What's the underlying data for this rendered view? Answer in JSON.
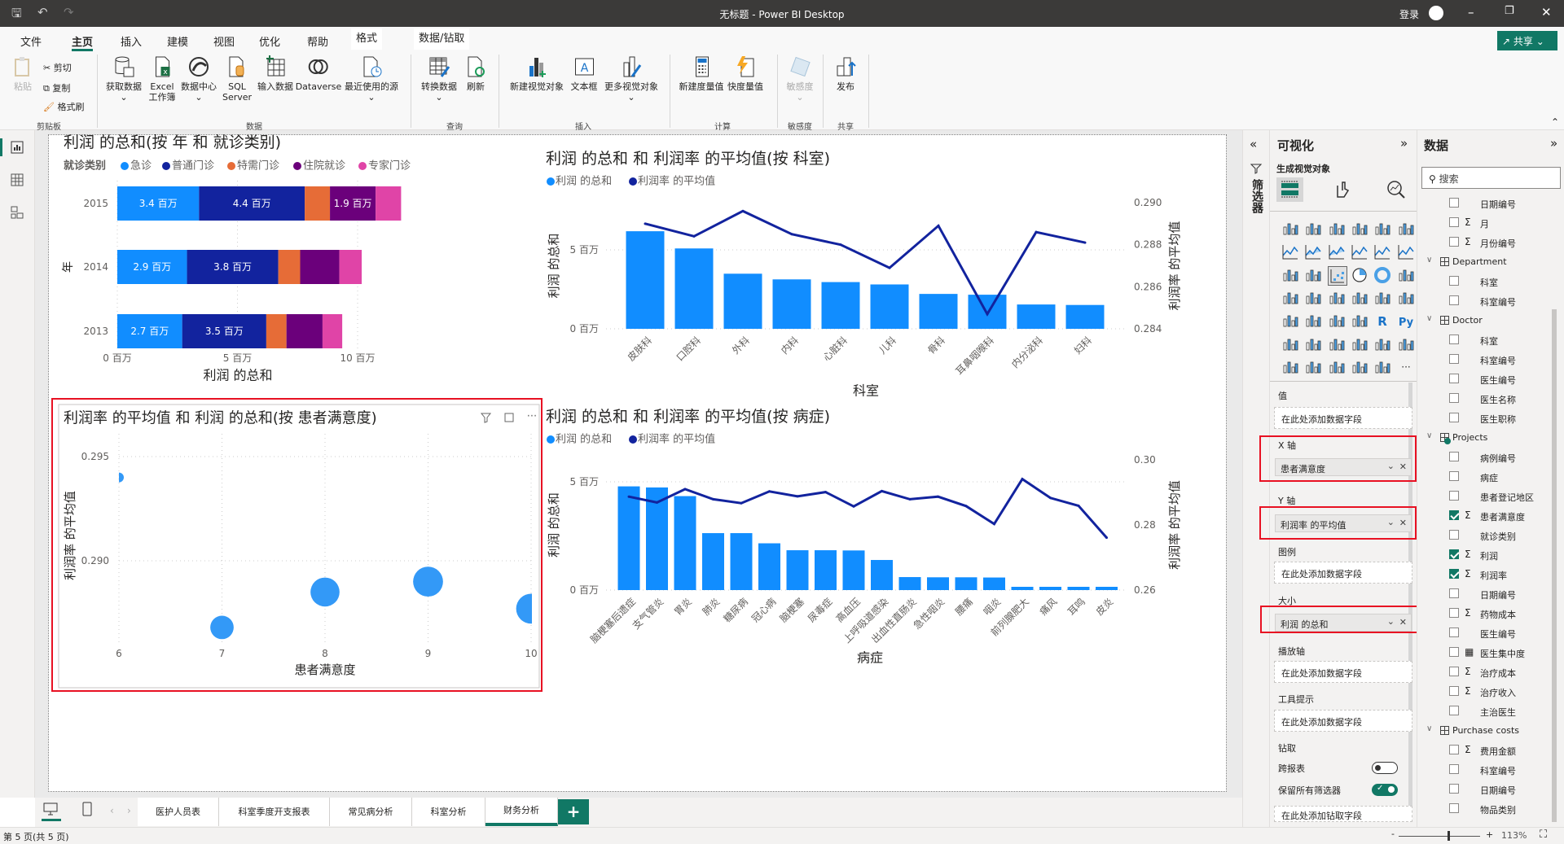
{
  "window": {
    "title": "无标题 - Power BI Desktop",
    "signin": "登录"
  },
  "menu_tabs": [
    "文件",
    "主页",
    "插入",
    "建模",
    "视图",
    "优化",
    "帮助",
    "格式",
    "数据/钻取"
  ],
  "active_menu_tab": "主页",
  "share_label": "共享",
  "ribbon": {
    "clipboard": {
      "paste": "粘贴",
      "cut": "剪切",
      "copy": "复制",
      "format_painter": "格式刷",
      "group": "剪贴板"
    },
    "data": {
      "get_data": "获取数据",
      "excel": "Excel",
      "excel2": "工作簿",
      "data_hub": "数据中心",
      "sql": "SQL",
      "sql2": "Server",
      "enter_data": "输入数据",
      "dataverse": "Dataverse",
      "recent": "最近使用的源",
      "group": "数据"
    },
    "query": {
      "transform": "转换数据",
      "refresh": "刷新",
      "group": "查询"
    },
    "insert": {
      "new_visual": "新建视觉对象",
      "text_box": "文本框",
      "more_visuals": "更多视觉对象",
      "group": "插入"
    },
    "calc": {
      "new_measure": "新建度量值",
      "quick_measure": "快度量值",
      "group": "计算"
    },
    "sensitivity": {
      "label": "敏感度",
      "group": "敏感度"
    },
    "share": {
      "publish": "发布",
      "group": "共享"
    }
  },
  "colors": {
    "急诊": "#118DFF",
    "普通门诊": "#12239E",
    "特需门诊": "#E66C37",
    "住院就诊": "#6B007B",
    "专家门诊": "#E044A7",
    "line": "#12239E",
    "accent": "#117865",
    "selection": "#E81123"
  },
  "chart_data": [
    {
      "type": "bar",
      "orientation": "horizontal-stacked",
      "title": "利润 的总和(按 年 和 就诊类别)",
      "legend_title": "就诊类别",
      "legend_position": "top-left",
      "categories": [
        "2015",
        "2014",
        "2013"
      ],
      "series": [
        {
          "name": "急诊",
          "values": [
            3.4,
            2.9,
            2.7
          ],
          "labels": [
            "3.4 百万",
            "2.9 百万",
            "2.7 百万"
          ]
        },
        {
          "name": "普通门诊",
          "values": [
            4.4,
            3.8,
            3.5
          ],
          "labels": [
            "4.4 百万",
            "3.8 百万",
            "3.5 百万"
          ]
        },
        {
          "name": "特需门诊",
          "values": [
            1.05,
            0.91,
            0.84
          ],
          "labels": [
            null,
            null,
            null
          ]
        },
        {
          "name": "住院就诊",
          "values": [
            1.9,
            1.63,
            1.5
          ],
          "labels": [
            "1.9 百万",
            null,
            null
          ]
        },
        {
          "name": "专家门诊",
          "values": [
            1.06,
            0.93,
            0.82
          ],
          "labels": [
            null,
            null,
            null
          ]
        }
      ],
      "xlabel": "利润 的总和",
      "ylabel": "年",
      "xticks": [
        "0 百万",
        "5 百万",
        "10 百万"
      ],
      "xtick_values": [
        0,
        5,
        10
      ],
      "unit": "百万",
      "grid": true
    },
    {
      "type": "bar+line",
      "title": "利润 的总和 和 利润率 的平均值(按 科室)",
      "legend": [
        "利润 的总和",
        "利润率 的平均值"
      ],
      "legend_position": "top-left",
      "categories": [
        "皮肤科",
        "口腔科",
        "外科",
        "内科",
        "心脏科",
        "儿科",
        "骨科",
        "耳鼻咽喉科",
        "内分泌科",
        "妇科"
      ],
      "series": [
        {
          "name": "利润 的总和",
          "type": "bar",
          "axis": "left",
          "values": [
            6.18,
            5.09,
            3.49,
            3.13,
            2.96,
            2.81,
            2.21,
            2.16,
            1.54,
            1.51
          ]
        },
        {
          "name": "利润率 的平均值",
          "type": "line",
          "axis": "right",
          "values": [
            0.289,
            0.2884,
            0.2896,
            0.2885,
            0.288,
            0.2869,
            0.2889,
            0.2847,
            0.2886,
            0.2881
          ]
        }
      ],
      "xlabel": "科室",
      "ylabel": "利润 的总和",
      "y2label": "利润率 的平均值",
      "yticks": [
        "0 百万",
        "5 百万"
      ],
      "ytick_values": [
        0,
        5
      ],
      "y2ticks": [
        "0.284",
        "0.286",
        "0.288",
        "0.290"
      ],
      "y2lim": [
        0.284,
        0.29
      ],
      "grid": true
    },
    {
      "type": "bar+line",
      "title": "利润 的总和 和 利润率 的平均值(按 病症)",
      "legend": [
        "利润 的总和",
        "利润率 的平均值"
      ],
      "legend_position": "top-left",
      "categories": [
        "脑梗塞后遗症",
        "支气管炎",
        "胃炎",
        "肺炎",
        "糖尿病",
        "冠心病",
        "脑梗塞",
        "尿毒症",
        "高血压",
        "上呼吸道感染",
        "出血性直肠炎",
        "急性咽炎",
        "腰痛",
        "咽炎",
        "前列腺肥大",
        "痛风",
        "耳鸣",
        "皮炎"
      ],
      "series": [
        {
          "name": "利润 的总和",
          "type": "bar",
          "axis": "left",
          "values": [
            4.79,
            4.74,
            4.34,
            2.63,
            2.63,
            2.16,
            1.84,
            1.84,
            1.83,
            1.39,
            0.6,
            0.59,
            0.59,
            0.58,
            0.15,
            0.15,
            0.15,
            0.15
          ]
        },
        {
          "name": "利润率 的平均值",
          "type": "line",
          "axis": "right",
          "values": [
            0.2887,
            0.2869,
            0.291,
            0.2879,
            0.2867,
            0.2903,
            0.2888,
            0.2901,
            0.2857,
            0.2904,
            0.2879,
            0.2887,
            0.2858,
            0.2803,
            0.2941,
            0.2883,
            0.2859,
            0.2761
          ]
        }
      ],
      "xlabel": "病症",
      "ylabel": "利润 的总和",
      "y2label": "利润率 的平均值",
      "yticks": [
        "0 百万",
        "5 百万"
      ],
      "ytick_values": [
        0,
        5
      ],
      "y2ticks": [
        "0.26",
        "0.28",
        "0.30"
      ],
      "y2lim": [
        0.26,
        0.3
      ],
      "grid": true
    },
    {
      "type": "scatter",
      "title": "利润率 的平均值 和 利润 的总和(按 患者满意度)",
      "x": [
        6,
        7,
        8,
        9,
        10
      ],
      "y": [
        0.294,
        0.2868,
        0.2885,
        0.289,
        0.2877
      ],
      "size": [
        0.9,
        5.2,
        8.0,
        8.5,
        8.5
      ],
      "size_field": "利润 的总和",
      "xlabel": "患者满意度",
      "ylabel": "利润率 的平均值",
      "xticks": [
        "6",
        "7",
        "8",
        "9",
        "10"
      ],
      "xlim": [
        6,
        10
      ],
      "yticks": [
        "0.290",
        "0.295"
      ],
      "ytick_values": [
        0.29,
        0.295
      ],
      "grid": true,
      "selected": true
    }
  ],
  "filters_pane": {
    "label": "筛选器"
  },
  "visualizations": {
    "title": "可视化",
    "subtitle": "生成视觉对象",
    "icons": [
      "stacked-bar",
      "stacked-column",
      "clustered-bar",
      "clustered-column",
      "100-stacked-bar",
      "100-stacked-column",
      "line",
      "area",
      "stacked-area",
      "line-clustered-column",
      "line-stacked-column",
      "ribbon",
      "waterfall",
      "funnel",
      "scatter",
      "pie",
      "donut",
      "treemap",
      "map",
      "filled-map",
      "azure-map",
      "gauge",
      "card",
      "multi-row-card",
      "kpi",
      "slicer",
      "table",
      "matrix",
      "R",
      "Py",
      "key-influencers",
      "decomposition-tree",
      "qa",
      "smart-narrative",
      "goals",
      "paginated-report",
      "new-card",
      "new-slicer",
      "arcgis-map",
      "power-apps",
      "power-automate",
      "more"
    ],
    "selected_icon": "scatter",
    "wells": {
      "values": {
        "label": "值",
        "placeholder": "在此处添加数据字段"
      },
      "x_axis": {
        "label": "X 轴",
        "field": "患者满意度"
      },
      "y_axis": {
        "label": "Y 轴",
        "field": "利润率 的平均值"
      },
      "legend": {
        "label": "图例",
        "placeholder": "在此处添加数据字段"
      },
      "size": {
        "label": "大小",
        "field": "利润 的总和"
      },
      "play_axis": {
        "label": "播放轴",
        "placeholder": "在此处添加数据字段"
      },
      "tooltips": {
        "label": "工具提示",
        "placeholder": "在此处添加数据字段"
      }
    },
    "drill": {
      "label": "钻取",
      "cross_report": "跨报表",
      "cross_report_on": false,
      "keep_filters": "保留所有筛选器",
      "keep_filters_on": true,
      "placeholder": "在此处添加钻取字段"
    }
  },
  "data_pane": {
    "title": "数据",
    "search_placeholder": "搜索",
    "items": [
      {
        "kind": "field",
        "label": "日期编号",
        "sigma": false,
        "checked": false
      },
      {
        "kind": "field",
        "label": "月",
        "sigma": true,
        "checked": false
      },
      {
        "kind": "field",
        "label": "月份编号",
        "sigma": true,
        "checked": false
      },
      {
        "kind": "table",
        "label": "Department"
      },
      {
        "kind": "field",
        "label": "科室",
        "sigma": false,
        "checked": false
      },
      {
        "kind": "field",
        "label": "科室编号",
        "sigma": false,
        "checked": false
      },
      {
        "kind": "table",
        "label": "Doctor"
      },
      {
        "kind": "field",
        "label": "科室",
        "sigma": false,
        "checked": false
      },
      {
        "kind": "field",
        "label": "科室编号",
        "sigma": false,
        "checked": false
      },
      {
        "kind": "field",
        "label": "医生编号",
        "sigma": false,
        "checked": false
      },
      {
        "kind": "field",
        "label": "医生名称",
        "sigma": false,
        "checked": false
      },
      {
        "kind": "field",
        "label": "医生职称",
        "sigma": false,
        "checked": false
      },
      {
        "kind": "table",
        "label": "Projects",
        "active": true
      },
      {
        "kind": "field",
        "label": "病例编号",
        "sigma": false,
        "checked": false
      },
      {
        "kind": "field",
        "label": "病症",
        "sigma": false,
        "checked": false
      },
      {
        "kind": "field",
        "label": "患者登记地区",
        "sigma": false,
        "checked": false
      },
      {
        "kind": "field",
        "label": "患者满意度",
        "sigma": true,
        "checked": true
      },
      {
        "kind": "field",
        "label": "就诊类别",
        "sigma": false,
        "checked": false
      },
      {
        "kind": "field",
        "label": "利润",
        "sigma": true,
        "checked": true
      },
      {
        "kind": "field",
        "label": "利润率",
        "sigma": true,
        "checked": true
      },
      {
        "kind": "field",
        "label": "日期编号",
        "sigma": false,
        "checked": false
      },
      {
        "kind": "field",
        "label": "药物成本",
        "sigma": true,
        "checked": false
      },
      {
        "kind": "field",
        "label": "医生编号",
        "sigma": false,
        "checked": false
      },
      {
        "kind": "field",
        "label": "医生集中度",
        "calc": true,
        "checked": false
      },
      {
        "kind": "field",
        "label": "治疗成本",
        "sigma": true,
        "checked": false
      },
      {
        "kind": "field",
        "label": "治疗收入",
        "sigma": true,
        "checked": false
      },
      {
        "kind": "field",
        "label": "主治医生",
        "sigma": false,
        "checked": false
      },
      {
        "kind": "table",
        "label": "Purchase costs"
      },
      {
        "kind": "field",
        "label": "费用金额",
        "sigma": true,
        "checked": false
      },
      {
        "kind": "field",
        "label": "科室编号",
        "sigma": false,
        "checked": false
      },
      {
        "kind": "field",
        "label": "日期编号",
        "sigma": false,
        "checked": false
      },
      {
        "kind": "field",
        "label": "物品类别",
        "sigma": false,
        "checked": false
      }
    ]
  },
  "page_tabs": [
    "医护人员表",
    "科室季度开支报表",
    "常见病分析",
    "科室分析",
    "财务分析"
  ],
  "active_page": "财务分析",
  "status": {
    "page_info": "第 5 页(共 5 页)",
    "zoom": "113%",
    "zoom_fraction": 0.6
  }
}
